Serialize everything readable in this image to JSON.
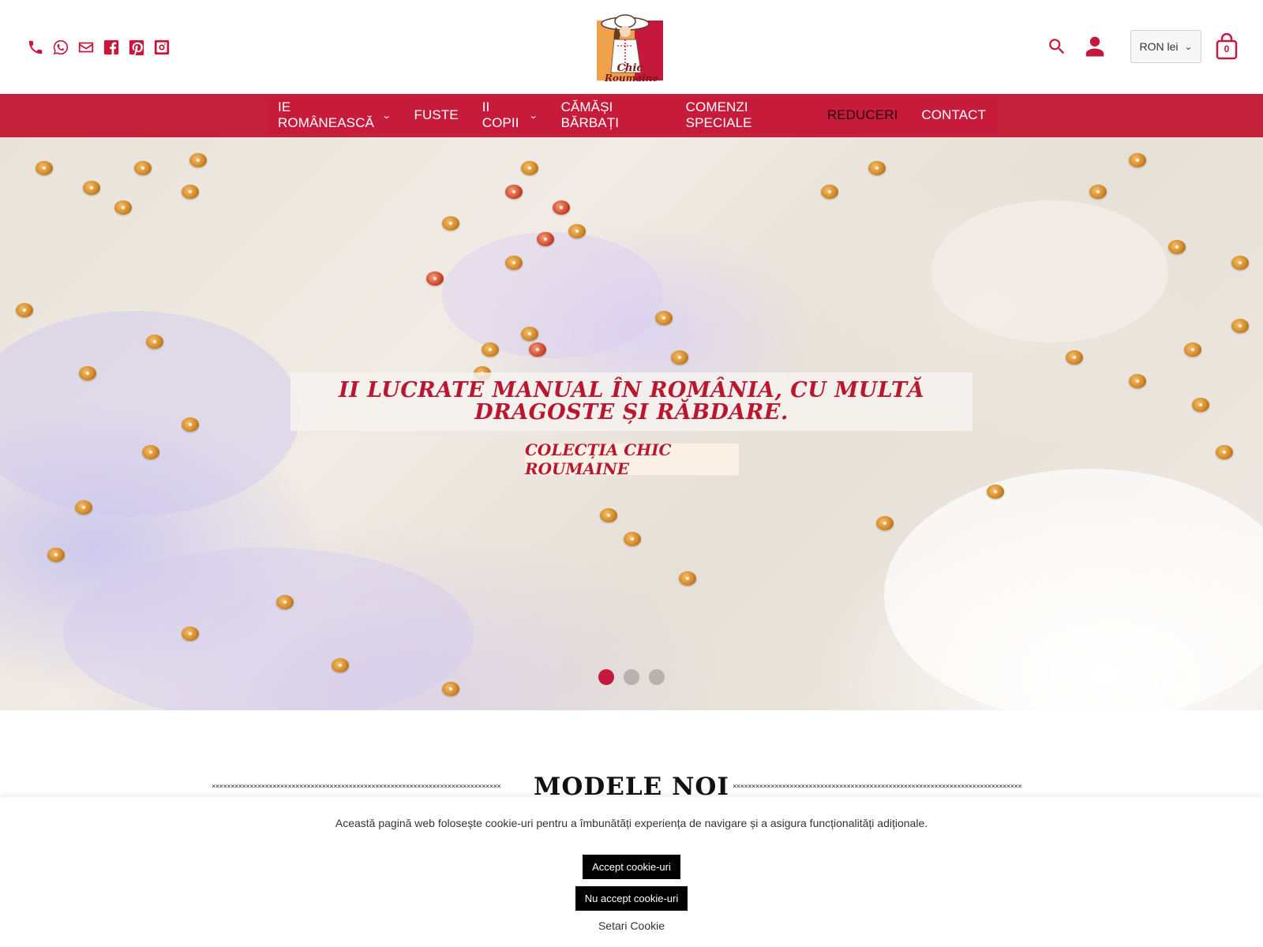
{
  "header": {
    "social_icons": [
      "phone-icon",
      "whatsapp-icon",
      "email-icon",
      "facebook-icon",
      "pinterest-icon",
      "instagram-icon"
    ],
    "logo_text": "Chic Roumaine",
    "currency": "RON lei",
    "cart_count": "0"
  },
  "nav": {
    "items": [
      {
        "label": "IE ROMÂNEASCĂ",
        "dropdown": true
      },
      {
        "label": "FUSTE",
        "dropdown": false
      },
      {
        "label": "II COPII",
        "dropdown": true
      },
      {
        "label": "CĂMĂȘI BĂRBAȚI",
        "dropdown": false
      },
      {
        "label": "COMENZI SPECIALE",
        "dropdown": false
      },
      {
        "label": "REDUCERI",
        "dropdown": false
      },
      {
        "label": "CONTACT",
        "dropdown": false
      }
    ]
  },
  "hero": {
    "title": "II LUCRATE MANUAL ÎN ROMÂNIA, CU MULTĂ DRAGOSTE ȘI RĂBDARE.",
    "button": "COLECȚIA CHIC ROUMAINE",
    "slides": 3,
    "active_slide": 1
  },
  "section": {
    "title": "MODELE NOI"
  },
  "cookie": {
    "text": "Această pagină web folosește cookie-uri pentru a îmbunătăți experiența de navigare și a asigura funcționalități adiționale.",
    "accept": "Accept cookie-uri",
    "decline": "Nu accept cookie-uri",
    "settings": "Setari Cookie"
  },
  "colors": {
    "brand": "#c4183c",
    "nav_bg": "#c4213d"
  }
}
